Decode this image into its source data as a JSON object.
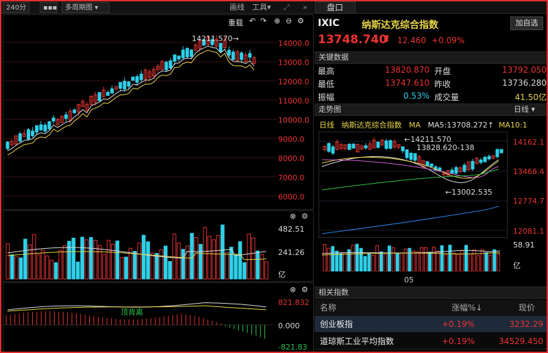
{
  "colors": {
    "up": "#e33333",
    "down": "#2fd0e8",
    "ma5": "#d8d8d8",
    "ma10": "#e8d44a",
    "bg": "#000000"
  },
  "toolbar": {
    "period": "240分",
    "more_icon": "more-icon",
    "period_dropdown": "多周期图",
    "draw_line": "画线",
    "tools": "工具",
    "expand_icon": "expand-icon",
    "collapse_icon": "chevron-right-icon"
  },
  "right_tab": {
    "label": "盘口"
  },
  "quote": {
    "code": "IXIC",
    "name": "纳斯达克综合指数",
    "add_button": "加自选",
    "price": "13748.740",
    "change": "12.460",
    "change_pct": "+0.09%"
  },
  "key_data": {
    "title": "关键数据",
    "rows": [
      {
        "l1": "最高",
        "v1": "13820.870",
        "l2": "开盘",
        "v2": "13792.050"
      },
      {
        "l1": "最低",
        "v1": "13747.610",
        "l2": "昨收",
        "v2": "13736.280"
      },
      {
        "l1": "振幅",
        "v1": "0.53%",
        "l2": "成交量",
        "v2": "41.50亿"
      }
    ]
  },
  "main_chart": {
    "redraw": "重载",
    "y_ticks": [
      "14000.0",
      "13000.0",
      "12000.0",
      "11000.0",
      "10000.0",
      "9000.0",
      "8000.0",
      "7000.0",
      "6000.0"
    ],
    "high_label": "14211.570→"
  },
  "volume_chart": {
    "y_ticks": [
      "482.51",
      "241.26",
      "亿"
    ]
  },
  "macd_chart": {
    "y_ticks": [
      "821.832",
      "0.000",
      "-821.83"
    ],
    "annotation": "顶背离"
  },
  "trend": {
    "title": "走势图",
    "period": "日线",
    "legend_period": "日线",
    "legend_name": "纳斯达克综合指数",
    "legend_ma": "MA",
    "ma5": "MA5:13708.272↑",
    "ma10": "MA10:1",
    "y_ticks": [
      "14162.1",
      "13468.4",
      "12774.7",
      "12081.1"
    ],
    "vol_ticks": [
      "58.91",
      "亿"
    ],
    "x_label": "05",
    "ann_high": "←14211.570",
    "ann_mid": "13828.620-138",
    "ann_low": "←13002.535"
  },
  "related": {
    "title": "相关指数",
    "headers": {
      "name": "名称",
      "pct": "涨幅%↓",
      "price": "现价"
    },
    "rows": [
      {
        "name": "创业板指",
        "pct": "+0.19%",
        "price": "3232.29"
      },
      {
        "name": "道琼斯工业平均指数",
        "pct": "+0.19%",
        "price": "34529.450"
      }
    ]
  }
}
